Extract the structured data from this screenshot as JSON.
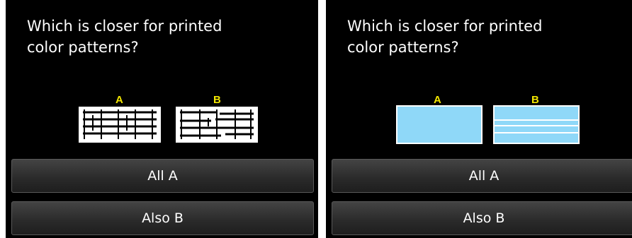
{
  "screens": [
    {
      "question": "Which is closer for printed\ncolor patterns?",
      "pattern_a_label": "A",
      "pattern_b_label": "B",
      "pattern_type": "black-and-white ruled lines",
      "button_all_a": "All A",
      "button_also_b": "Also B"
    },
    {
      "question": "Which is closer for printed\ncolor patterns?",
      "pattern_a_label": "A",
      "pattern_b_label": "B",
      "pattern_type": "light-blue color blocks",
      "button_all_a": "All A",
      "button_also_b": "Also B"
    }
  ],
  "colors": {
    "screen_background": "#000000",
    "label_yellow": "#f2e600",
    "swatch_blue": "#8fd8f8",
    "text": "#ffffff"
  }
}
